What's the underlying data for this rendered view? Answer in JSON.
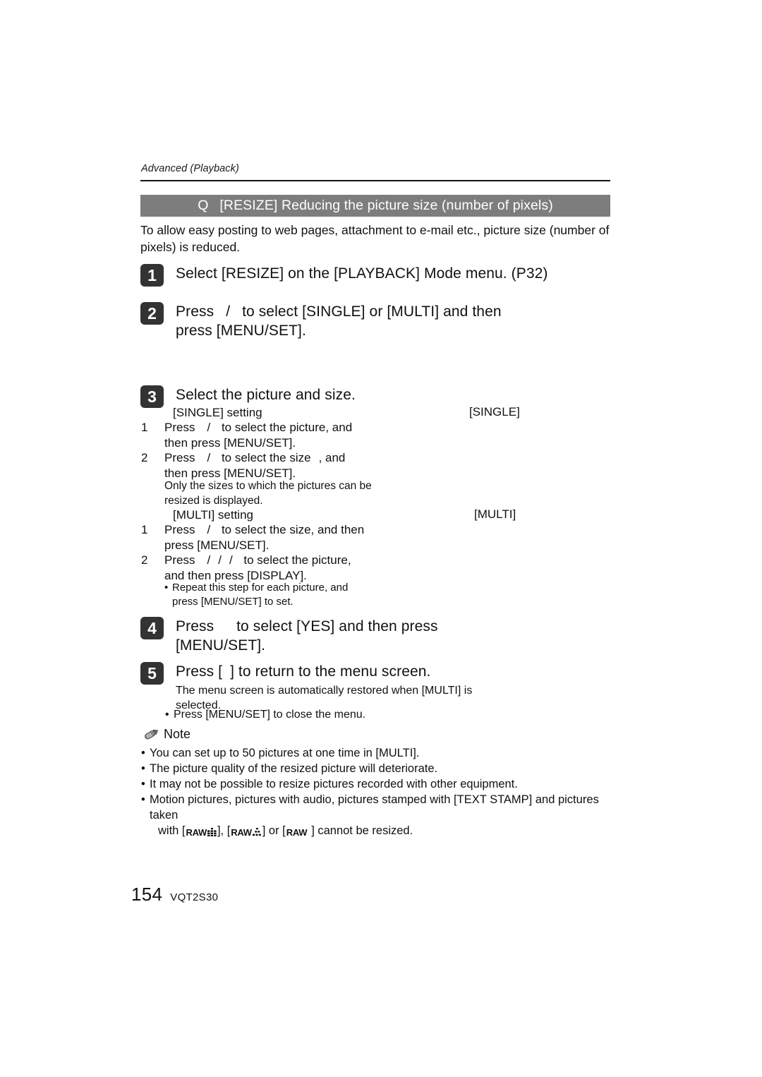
{
  "page": {
    "running_head": "Advanced (Playback)",
    "page_number": "154",
    "doc_code": "VQT2S30",
    "title_bar": {
      "mark": "Q",
      "text": "[RESIZE] Reducing the picture size (number of pixels)",
      "background_color": "#7d7d7d",
      "text_color": "#ffffff"
    },
    "intro": "To allow easy posting to web pages, attachment to e-mail etc., picture size (number of pixels) is reduced."
  },
  "steps": [
    {
      "number": "1",
      "text": "Select [RESIZE] on the [PLAYBACK] Mode menu. (P32)"
    },
    {
      "number": "2",
      "line1_a": "Press",
      "line1_slash": "/",
      "line1_b": "to select [SINGLE] or [MULTI] and then",
      "line2": "press [MENU/SET]."
    },
    {
      "number": "3",
      "text": "Select the picture and size."
    },
    {
      "number": "4",
      "line1_a": "Press",
      "line1_b": "to select [YES] and then press",
      "line2": "[MENU/SET]."
    },
    {
      "number": "5",
      "text_a": "Press [",
      "text_b": "] to return to the menu screen."
    }
  ],
  "single_block": {
    "heading": "[SINGLE] setting",
    "right_label": "[SINGLE]",
    "items": [
      {
        "num": "1",
        "line1_a": "Press",
        "line1_slash": "/",
        "line1_b": "to select the picture, and",
        "line2": "then press [MENU/SET]."
      },
      {
        "num": "2",
        "line1_a": "Press",
        "line1_slash": "/",
        "line1_b": "to select the size",
        "line1_c": ", and",
        "line2": "then press [MENU/SET]."
      }
    ],
    "note_line1": "Only the sizes to which the pictures can be",
    "note_line2": "resized is displayed."
  },
  "multi_block": {
    "heading": "[MULTI] setting",
    "right_label": "[MULTI]",
    "items": [
      {
        "num": "1",
        "line1_a": "Press",
        "line1_slash": "/",
        "line1_b": "to select the size, and then",
        "line2": "press [MENU/SET]."
      },
      {
        "num": "2",
        "line1_a": "Press",
        "line1_slash1": "/",
        "line1_slash2": "/",
        "line1_slash3": "/",
        "line1_b": "to select the picture,",
        "line2": "and then press [DISPLAY]."
      }
    ],
    "bullet_line1": "Repeat this step for each picture, and",
    "bullet_line2": "press [MENU/SET] to set."
  },
  "step5_detail": {
    "line1": "The menu screen is automatically restored when [MULTI] is",
    "line2": "selected.",
    "bullet": "Press [MENU/SET] to close the menu."
  },
  "note_section": {
    "label": "Note",
    "icon": "pencil-icon",
    "bullets": [
      "You can set up to 50 pictures at one time in [MULTI].",
      "The picture quality of the resized picture will deteriorate.",
      "It may not be possible to resize pictures recorded with other equipment."
    ],
    "last_bullet": {
      "line1": "Motion pictures, pictures with audio, pictures stamped with [TEXT STAMP] and pictures taken",
      "line2_a": "with [",
      "raw1": "RAW",
      "line2_b": "], [",
      "raw2": "RAW",
      "line2_c": "] or [",
      "raw3": "RAW",
      "line2_d": "] cannot be resized."
    }
  }
}
